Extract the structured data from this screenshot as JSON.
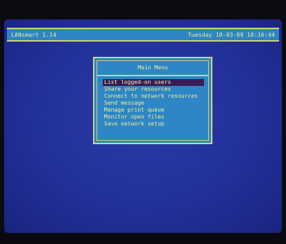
{
  "topbar": {
    "left_text": "LANsmart 1.14",
    "right_text": "Tuesday 10-03-89 18:16:44"
  },
  "main_menu": {
    "title": "Main Menu",
    "items": [
      {
        "label": "List logged-on users",
        "selected": true
      },
      {
        "label": "Share your resources",
        "selected": false
      },
      {
        "label": "Connect to network resources",
        "selected": false
      },
      {
        "label": "Send message",
        "selected": false
      },
      {
        "label": "Manage print queue",
        "selected": false
      },
      {
        "label": "Monitor open files",
        "selected": false
      },
      {
        "label": "Save network setup",
        "selected": false
      }
    ]
  },
  "colors": {
    "background_blue": "#22309a",
    "panel_blue": "#2e86c4",
    "border_yellow": "#d7d37a",
    "text_yellow": "#f0ef9a",
    "selected_bg": "#3a1b53"
  }
}
